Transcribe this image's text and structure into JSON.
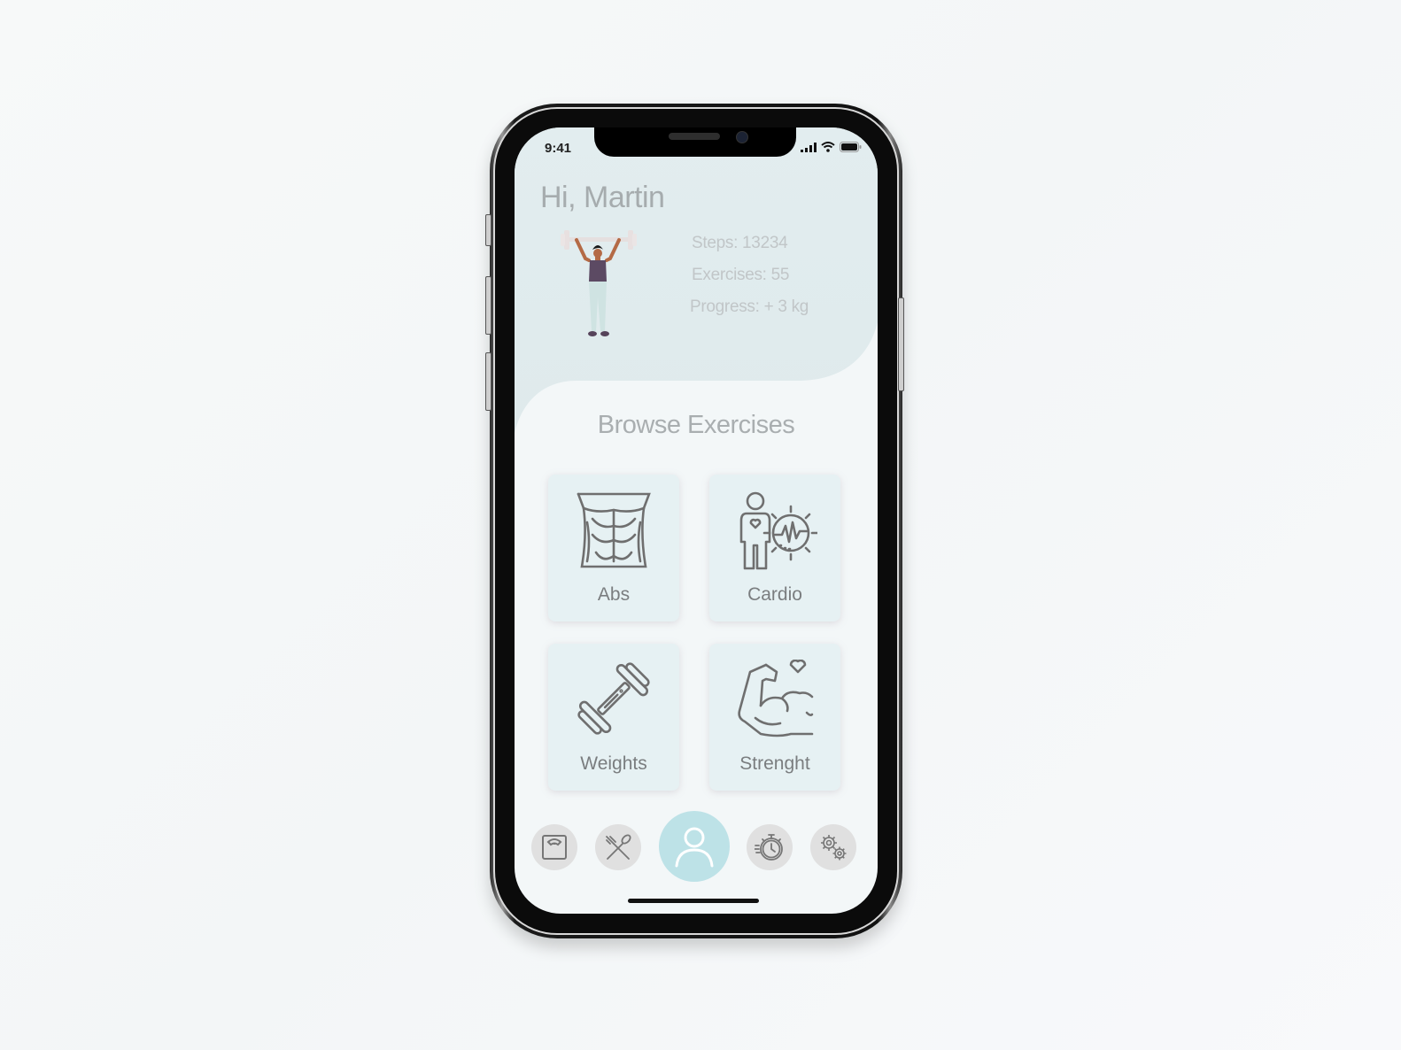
{
  "status_bar": {
    "time": "9:41",
    "icons": [
      "cellular-signal-icon",
      "wifi-icon",
      "battery-icon"
    ]
  },
  "header": {
    "greeting": "Hi, Martin",
    "illustration": "weightlifter-illustration"
  },
  "stats": [
    {
      "label": "Steps: 13234"
    },
    {
      "label": "Exercises: 55"
    },
    {
      "label": "Progress: + 3 kg"
    }
  ],
  "browse": {
    "title": "Browse Exercises",
    "categories": [
      {
        "label": "Abs",
        "icon": "abs-torso-icon"
      },
      {
        "label": "Cardio",
        "icon": "cardio-heartbeat-icon"
      },
      {
        "label": "Weights",
        "icon": "dumbbell-icon"
      },
      {
        "label": "Strenght",
        "icon": "flexed-bicep-icon"
      }
    ]
  },
  "bottom_nav": {
    "items": [
      {
        "name": "scale",
        "icon": "bathroom-scale-icon",
        "active": false
      },
      {
        "name": "nutrition",
        "icon": "fork-spoon-icon",
        "active": false
      },
      {
        "name": "profile",
        "icon": "user-icon",
        "active": true
      },
      {
        "name": "timer",
        "icon": "stopwatch-icon",
        "active": false
      },
      {
        "name": "settings",
        "icon": "gears-icon",
        "active": false
      }
    ]
  },
  "colors": {
    "accent": "#bde2e7",
    "hero_background": "#e1ecee",
    "screen_background": "#f3f7f8",
    "card_background": "#e6f1f3",
    "nav_button": "#e0e0e0",
    "text_muted": "#a6acae"
  }
}
